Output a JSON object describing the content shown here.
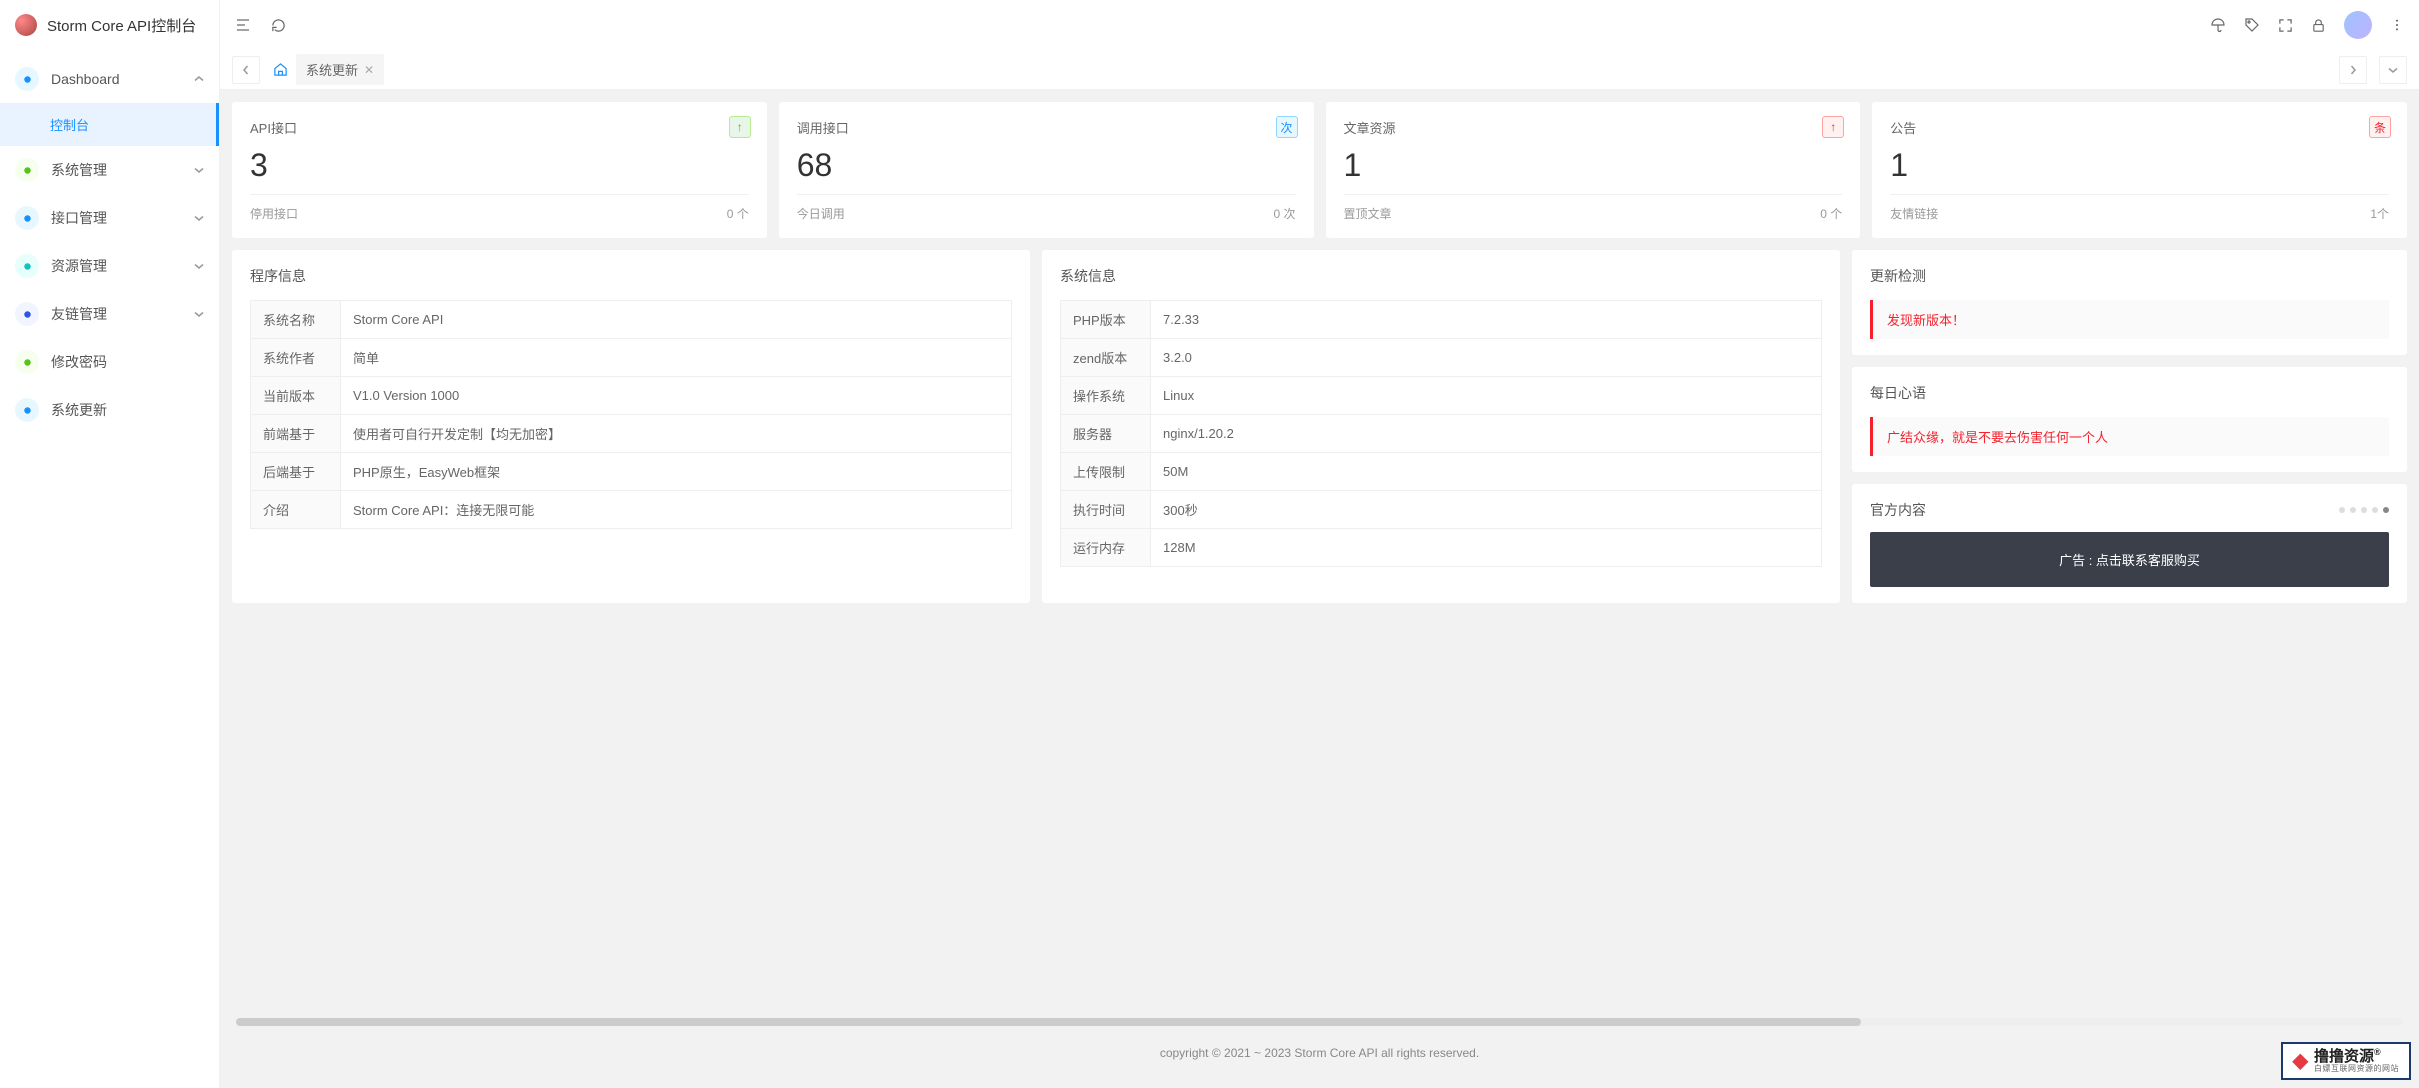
{
  "app": {
    "title": "Storm Core API控制台"
  },
  "sidebar": {
    "items": [
      {
        "label": "Dashboard",
        "icon_bg": "#e6f7ff",
        "icon_color": "#1890ff",
        "expandable": true,
        "expanded": true,
        "sub": [
          {
            "label": "控制台",
            "active": true
          }
        ]
      },
      {
        "label": "系统管理",
        "icon_bg": "#f6ffed",
        "icon_color": "#52c41a",
        "expandable": true
      },
      {
        "label": "接口管理",
        "icon_bg": "#e6f7ff",
        "icon_color": "#1890ff",
        "expandable": true
      },
      {
        "label": "资源管理",
        "icon_bg": "#e6fffb",
        "icon_color": "#13c2c2",
        "expandable": true
      },
      {
        "label": "友链管理",
        "icon_bg": "#f0f5ff",
        "icon_color": "#2f54eb",
        "expandable": true
      },
      {
        "label": "修改密码",
        "icon_bg": "#f6ffed",
        "icon_color": "#52c41a",
        "expandable": false
      },
      {
        "label": "系统更新",
        "icon_bg": "#e6f7ff",
        "icon_color": "#1890ff",
        "expandable": false
      }
    ]
  },
  "tabs": {
    "current": "系统更新"
  },
  "stats": [
    {
      "title": "API接口",
      "value": "3",
      "sub_label": "停用接口",
      "sub_value": "0 个",
      "badge": "↑",
      "badge_class": "badge-green"
    },
    {
      "title": "调用接口",
      "value": "68",
      "sub_label": "今日调用",
      "sub_value": "0 次",
      "badge": "次",
      "badge_class": "badge-blue"
    },
    {
      "title": "文章资源",
      "value": "1",
      "sub_label": "置顶文章",
      "sub_value": "0 个",
      "badge": "↑",
      "badge_class": "badge-red"
    },
    {
      "title": "公告",
      "value": "1",
      "sub_label": "友情链接",
      "sub_value": "1个",
      "badge": "条",
      "badge_class": "badge-red"
    }
  ],
  "program_info": {
    "title": "程序信息",
    "rows": [
      {
        "k": "系统名称",
        "v": "Storm Core API"
      },
      {
        "k": "系统作者",
        "v": "简单"
      },
      {
        "k": "当前版本",
        "v": "V1.0 Version 1000"
      },
      {
        "k": "前端基于",
        "v": "使用者可自行开发定制【均无加密】"
      },
      {
        "k": "后端基于",
        "v": "PHP原生，EasyWeb框架"
      },
      {
        "k": "介绍",
        "v": "Storm Core API：连接无限可能"
      }
    ]
  },
  "system_info": {
    "title": "系统信息",
    "rows": [
      {
        "k": "PHP版本",
        "v": "7.2.33"
      },
      {
        "k": "zend版本",
        "v": "3.2.0"
      },
      {
        "k": "操作系统",
        "v": "Linux"
      },
      {
        "k": "服务器",
        "v": "nginx/1.20.2"
      },
      {
        "k": "上传限制",
        "v": "50M"
      },
      {
        "k": "执行时间",
        "v": "300秒"
      },
      {
        "k": "运行内存",
        "v": "128M"
      }
    ]
  },
  "right": {
    "update_title": "更新检测",
    "update_msg": "发现新版本！",
    "daily_title": "每日心语",
    "daily_msg": "广结众缘，就是不要去伤害任何一个人",
    "official_title": "官方内容",
    "ad_text": "广告 : 点击联系客服购买"
  },
  "footer": {
    "text": "copyright © 2021 ~ 2023 Storm Core API all rights reserved."
  },
  "watermark": {
    "main": "撸撸资源",
    "sub": "白嫖互联网资源的网站"
  }
}
